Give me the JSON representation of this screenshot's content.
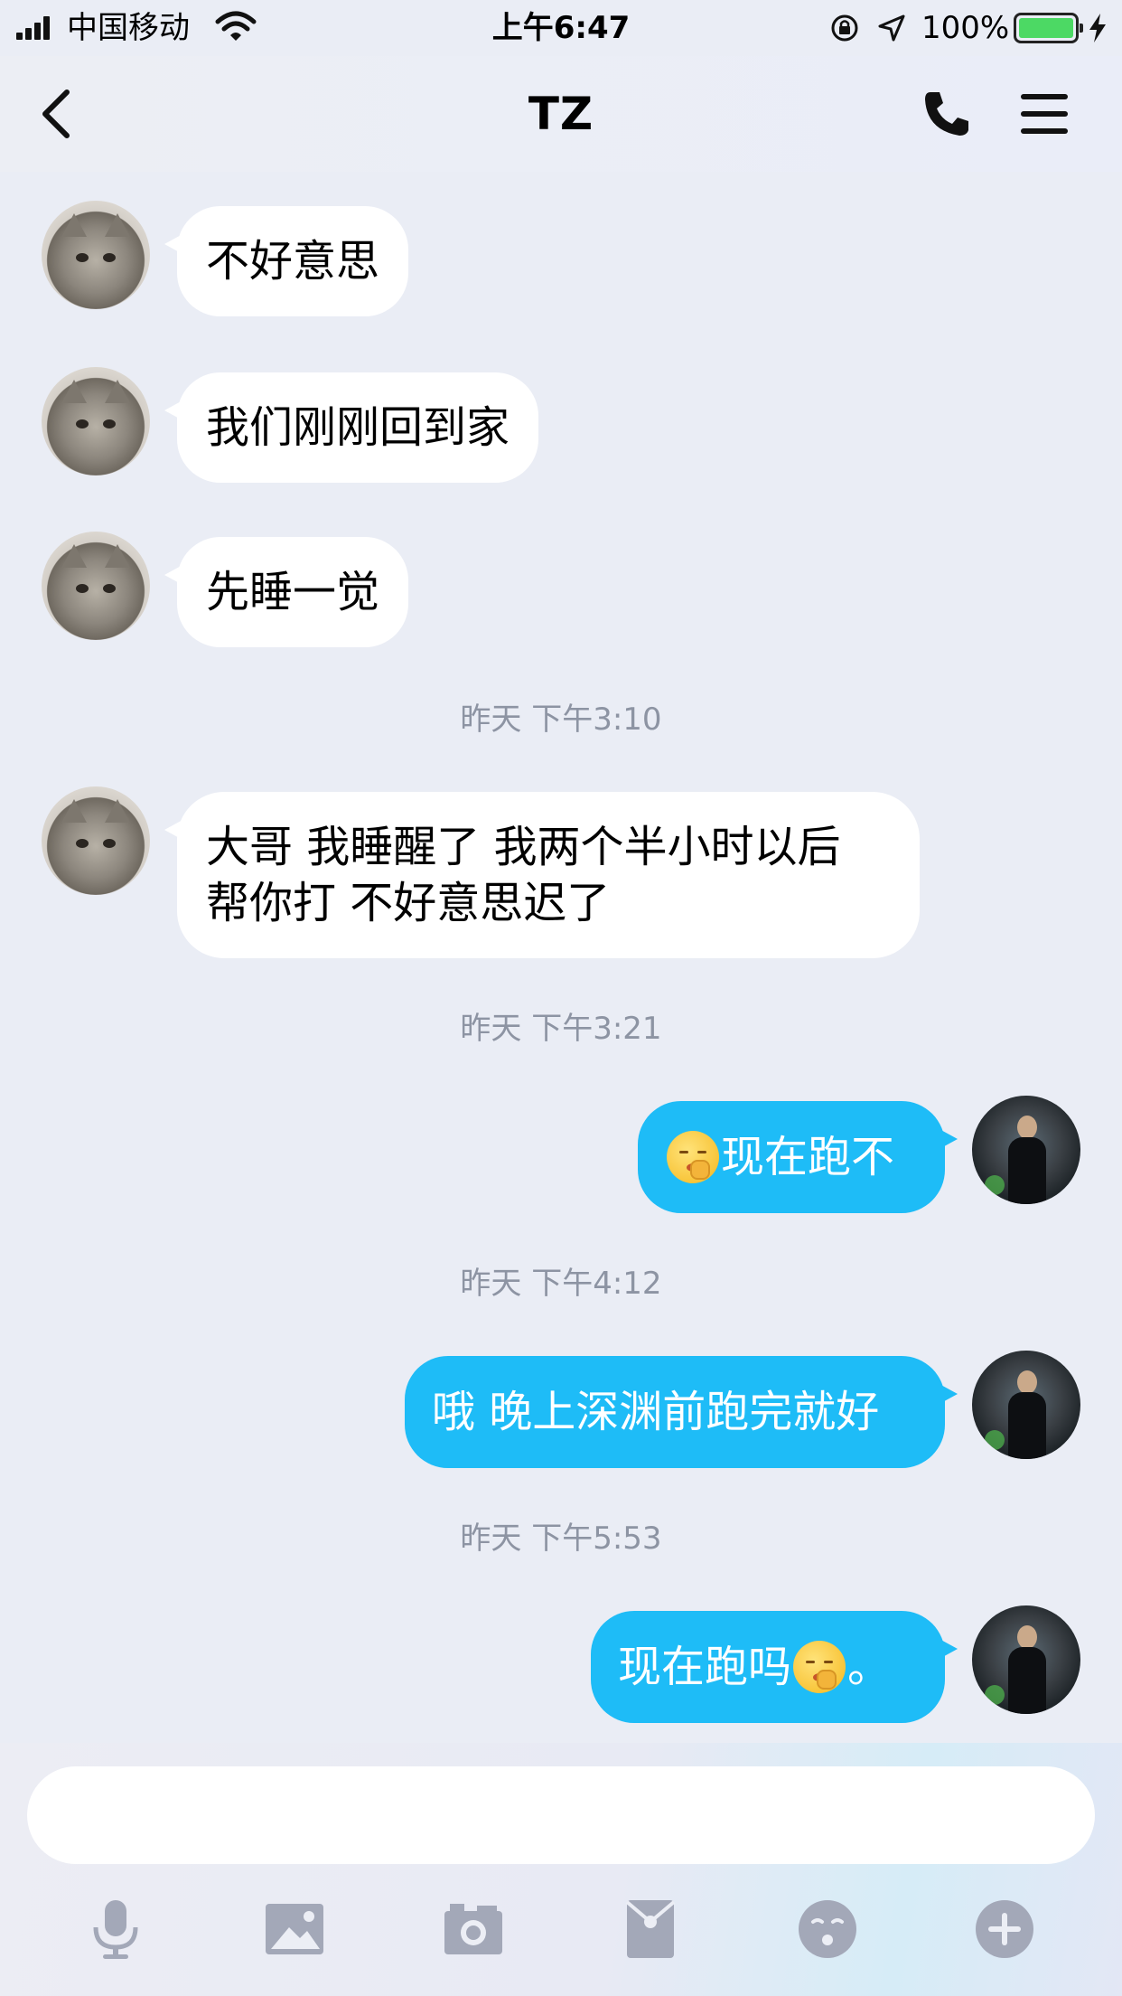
{
  "status_bar": {
    "carrier": "中国移动",
    "time": "上午6:47",
    "battery_percent": "100%"
  },
  "header": {
    "title": "TZ"
  },
  "messages": [
    {
      "direction": "incoming",
      "text": "不好意思"
    },
    {
      "direction": "incoming",
      "text": "我们刚刚回到家"
    },
    {
      "direction": "incoming",
      "text": "先睡一觉"
    },
    {
      "type": "timestamp",
      "text": "昨天  下午3:10"
    },
    {
      "direction": "incoming",
      "lines": [
        "大哥 我睡醒了 我两个半小时以后",
        "帮你打  不好意思迟了"
      ]
    },
    {
      "type": "timestamp",
      "text": "昨天  下午3:21"
    },
    {
      "direction": "outgoing",
      "emoji": "shush-face",
      "text": "现在跑不"
    },
    {
      "type": "timestamp",
      "text": "昨天  下午4:12"
    },
    {
      "direction": "outgoing",
      "text": "哦 晚上深渊前跑完就好"
    },
    {
      "type": "timestamp",
      "text": "昨天  下午5:53"
    },
    {
      "direction": "outgoing",
      "text_before": "现在跑吗",
      "emoji": "shush-face",
      "text_after": "。"
    }
  ],
  "input": {
    "value": ""
  },
  "toolbar": [
    "microphone-icon",
    "image-icon",
    "camera-icon",
    "red-packet-icon",
    "emoji-icon",
    "plus-icon"
  ],
  "colors": {
    "background": "#eaedf5",
    "outgoing_bubble": "#1ebcf7",
    "incoming_bubble": "#ffffff",
    "timestamp": "#8d94a3",
    "toolbar_icon": "#a3a8b8"
  }
}
